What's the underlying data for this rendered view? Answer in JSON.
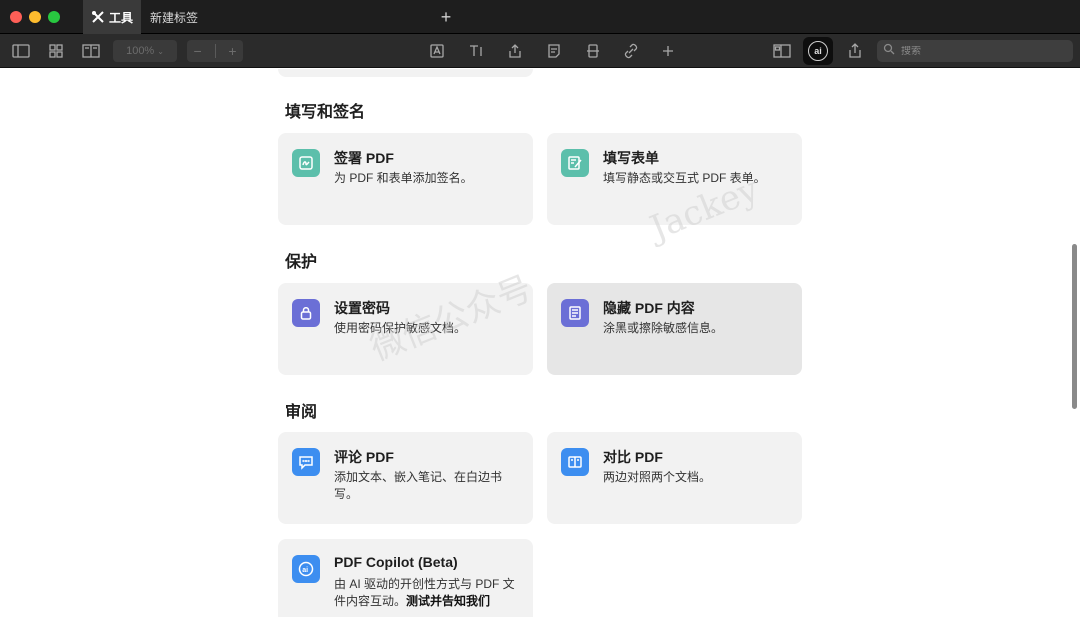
{
  "titlebar": {
    "active_tab": "工具",
    "second_tab": "新建标签",
    "add_tab": "+"
  },
  "toolbar": {
    "zoom": "100%",
    "zoom_out": "−",
    "zoom_in": "+",
    "search_placeholder": "搜索",
    "ai_label": "ai"
  },
  "sections": [
    {
      "title": "填写和签名",
      "cards": [
        {
          "title": "签署 PDF",
          "desc": "为 PDF 和表单添加签名。",
          "icon": "sign-icon",
          "color": "#5cbfab"
        },
        {
          "title": "填写表单",
          "desc": "填写静态或交互式 PDF 表单。",
          "icon": "fill-form-icon",
          "color": "#5cbfab"
        }
      ]
    },
    {
      "title": "保护",
      "cards": [
        {
          "title": "设置密码",
          "desc": "使用密码保护敏感文档。",
          "icon": "lock-icon",
          "color": "#6b6fd6"
        },
        {
          "title": "隐藏 PDF 内容",
          "desc": "涂黑或擦除敏感信息。",
          "icon": "redact-icon",
          "color": "#6b6fd6"
        }
      ]
    },
    {
      "title": "审阅",
      "cards": [
        {
          "title": "评论 PDF",
          "desc": "添加文本、嵌入笔记、在白边书写。",
          "icon": "comment-icon",
          "color": "#3d8ef0"
        },
        {
          "title": "对比 PDF",
          "desc": "两边对照两个文档。",
          "icon": "compare-icon",
          "color": "#3d8ef0"
        },
        {
          "title": "PDF Copilot (Beta)",
          "desc": "由 AI 驱动的开创性方式与 PDF 文件内容互动。",
          "desc_bold": "测试并告知我们",
          "icon": "ai-copilot-icon",
          "color": "#3d8ef0"
        }
      ]
    }
  ],
  "watermark": {
    "line1": "微信公众号",
    "line2": "Jackey"
  }
}
